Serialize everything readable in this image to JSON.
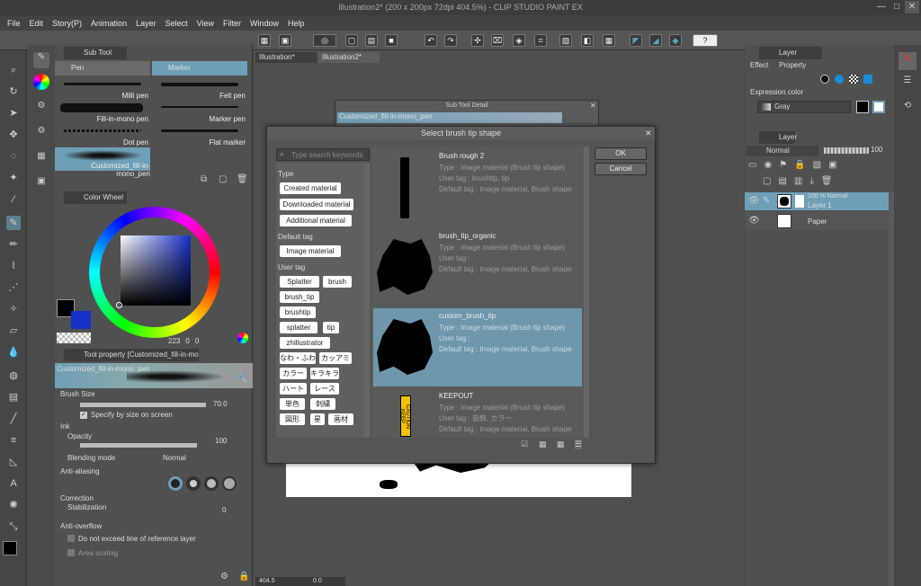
{
  "window": {
    "title": "Illustration2* (200 x 200px 72dpi 404.5%) - CLIP STUDIO PAINT EX",
    "controls": [
      "—",
      "□",
      "✕"
    ]
  },
  "menu": [
    "File",
    "Edit",
    "Story(P)",
    "Animation",
    "Layer",
    "Select",
    "View",
    "Filter",
    "Window",
    "Help"
  ],
  "doc_tabs": [
    "Illustration*",
    "Illustration2*"
  ],
  "sub_tool": {
    "panel_title": "Sub Tool [Pen]",
    "tabs": [
      "Pen",
      "Marker"
    ],
    "pens": [
      "Milli pen",
      "Felt pen",
      "Fill-in-mono pen",
      "Marker pen",
      "Dot pen",
      "Flat marker",
      "Customized_fill-in-mono_pen"
    ]
  },
  "color_wheel": {
    "title": "Color Wheel",
    "values": [
      "223",
      "0",
      "0"
    ],
    "value_labels": [
      "H",
      "S",
      "V"
    ]
  },
  "tool_property": {
    "title": "Tool property [Customized_fill-in-mono_pen]",
    "preset_name": "Customized_fill-in-mono_pen",
    "brush_size_label": "Brush Size",
    "brush_size_value": "70.0",
    "specify_label": "Specify by size on screen",
    "ink_label": "Ink",
    "opacity_label": "Opacity",
    "opacity_value": "100",
    "blending_label": "Blending mode",
    "blending_value": "Normal",
    "aa_label": "Anti-aliasing",
    "correction_label": "Correction",
    "stabilization_label": "Stabilization",
    "stabilization_value": "0",
    "antioverflow_label": "Anti-overflow",
    "reference_label": "Do not exceed line of reference layer",
    "area_scaling_label": "Area scaling"
  },
  "sub_tool_detail": {
    "title": "Sub Tool Detail",
    "preset_name": "Customized_fill-in-mono_pen"
  },
  "dialog": {
    "title": "Select brush tip shape",
    "search_placeholder": "Type search keywords",
    "ok": "OK",
    "cancel": "Cancel",
    "type_label": "Type",
    "types": [
      "Created material",
      "Downloaded material",
      "Additional material"
    ],
    "default_tag_label": "Default tag",
    "default_tags": [
      "Image material"
    ],
    "user_tag_label": "User tag",
    "user_tags": [
      "Splatter",
      "brush",
      "brush_tip",
      "brushtip",
      "splatter",
      "tip",
      "zhillustrator",
      "なわ・ふわ",
      "カッアミ",
      "カラー",
      "キラキラ",
      "ハート",
      "レース",
      "単色",
      "刺繍",
      "図形",
      "星",
      "画材"
    ],
    "items": [
      {
        "name": "Brush rough 2",
        "type": "Type : Image material (Brush tip shape)",
        "user_tag": "User tag : brushtip, tip",
        "default_tag": "Default tag : Image material, Brush shape"
      },
      {
        "name": "brush_tip_organic",
        "type": "Type : Image material (Brush tip shape)",
        "user_tag": "User tag :",
        "default_tag": "Default tag : Image material, Brush shape"
      },
      {
        "name": "custom_brush_tip",
        "type": "Type : Image material (Brush tip shape)",
        "user_tag": "User tag :",
        "default_tag": "Default tag : Image material, Brush shape"
      },
      {
        "name": "KEEPOUT",
        "type": "Type : Image material (Brush tip shape)",
        "user_tag": "User tag : 装飾, カラー",
        "default_tag": "Default tag : Image material, Brush shape"
      }
    ],
    "keepout_text": "CAUTION KEEP"
  },
  "layer_property": {
    "title": "Layer Property",
    "effect_label": "Effect",
    "expression_label": "Expression color",
    "expression_value": "Gray"
  },
  "layer_panel": {
    "title": "Layer",
    "blend": "Normal",
    "opacity": "100",
    "layers": [
      {
        "name": "Layer 1",
        "info": "100 % Normal"
      },
      {
        "name": "Paper",
        "info": ""
      }
    ]
  },
  "status": {
    "zoom": "404.5",
    "angle": "0.0"
  },
  "colors": {
    "main_color": "#000000",
    "sub_color": "#1630c8",
    "accent": "#6f9fb6",
    "selected_item": "#6e97ab"
  }
}
